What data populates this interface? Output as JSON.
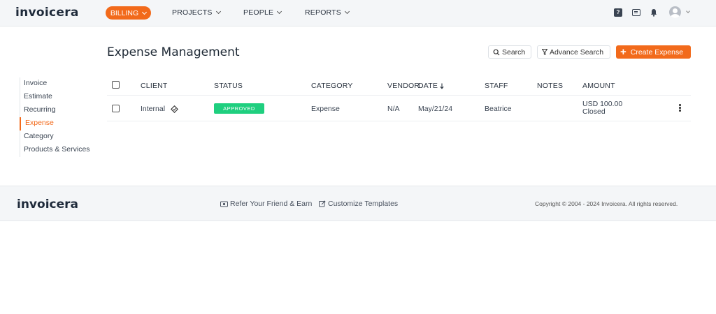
{
  "header": {
    "logo_text": "invoicera",
    "nav": {
      "billing": "BILLING",
      "projects": "PROJECTS",
      "people": "PEOPLE",
      "reports": "REPORTS"
    },
    "icons": [
      "help-icon",
      "keyboard-icon",
      "bell-icon",
      "user-avatar-icon"
    ]
  },
  "sidebar": {
    "items": [
      {
        "label": "Invoice",
        "active": false
      },
      {
        "label": "Estimate",
        "active": false
      },
      {
        "label": "Recurring",
        "active": false
      },
      {
        "label": "Expense",
        "active": true
      },
      {
        "label": "Category",
        "active": false
      },
      {
        "label": "Products & Services",
        "active": false
      }
    ]
  },
  "main": {
    "title": "Expense Management",
    "search_label": "Search",
    "advance_search_label": "Advance Search",
    "create_label": "Create Expense"
  },
  "table": {
    "columns": {
      "client": "CLIENT",
      "status": "STATUS",
      "category": "CATEGORY",
      "vendor": "VENDOR",
      "date": "DATE",
      "staff": "STAFF",
      "notes": "NOTES",
      "amount": "AMOUNT"
    },
    "rows": [
      {
        "client": "Internal",
        "status": "APPROVED",
        "category": "Expense",
        "vendor": "N/A",
        "date": "May/21/24",
        "staff": "Beatrice",
        "notes": "",
        "amount": "USD 100.00",
        "amount_status": "Closed"
      }
    ]
  },
  "footer": {
    "logo_text": "invoicera",
    "refer_label": "Refer Your Friend & Earn",
    "customize_label": "Customize Templates",
    "copyright": "Copyright © 2004 - 2024 Invoicera. All rights reserved."
  },
  "colors": {
    "accent": "#f26a1b",
    "approved": "#1fcf7f",
    "topbar_bg": "#f4f6f8"
  }
}
